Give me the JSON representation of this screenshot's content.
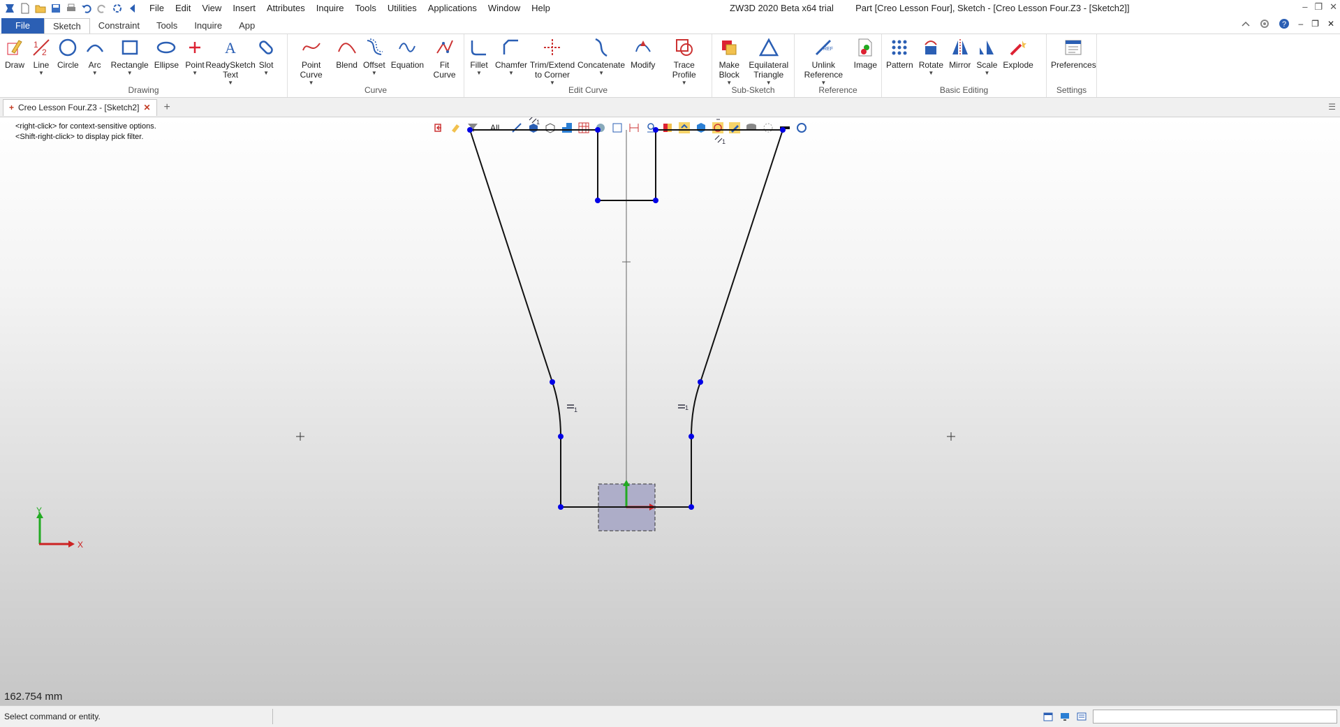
{
  "titlebar": {
    "menu": [
      "File",
      "Edit",
      "View",
      "Insert",
      "Attributes",
      "Inquire",
      "Tools",
      "Utilities",
      "Applications",
      "Window",
      "Help"
    ],
    "app_name": "ZW3D 2020 Beta x64 trial",
    "document": "Part [Creo Lesson Four],  Sketch - [Creo Lesson Four.Z3 - [Sketch2]]"
  },
  "ribbon_tabs": [
    "File",
    "Sketch",
    "Constraint",
    "Tools",
    "Inquire",
    "App"
  ],
  "ribbon": {
    "drawing": {
      "label": "Drawing",
      "buttons": [
        {
          "label": "Draw",
          "icon": "draw-icon"
        },
        {
          "label": "Line",
          "icon": "line-icon"
        },
        {
          "label": "Circle",
          "icon": "circle-icon"
        },
        {
          "label": "Arc",
          "icon": "arc-icon"
        },
        {
          "label": "Rectangle",
          "icon": "rectangle-icon"
        },
        {
          "label": "Ellipse",
          "icon": "ellipse-icon"
        },
        {
          "label": "Point",
          "icon": "point-icon"
        },
        {
          "label": "ReadySketch Text",
          "icon": "text-icon"
        },
        {
          "label": "Slot",
          "icon": "slot-icon"
        }
      ]
    },
    "curve": {
      "label": "Curve",
      "buttons": [
        {
          "label": "Point Curve",
          "icon": "point-curve-icon"
        },
        {
          "label": "Blend",
          "icon": "blend-icon"
        },
        {
          "label": "Offset",
          "icon": "offset-icon"
        },
        {
          "label": "Equation",
          "icon": "equation-icon"
        },
        {
          "label": "Fit Curve",
          "icon": "fit-curve-icon"
        }
      ]
    },
    "edit_curve": {
      "label": "Edit Curve",
      "buttons": [
        {
          "label": "Fillet",
          "icon": "fillet-icon"
        },
        {
          "label": "Chamfer",
          "icon": "chamfer-icon"
        },
        {
          "label": "Trim/Extend to Corner",
          "icon": "trim-icon"
        },
        {
          "label": "Concatenate",
          "icon": "concatenate-icon"
        },
        {
          "label": "Modify",
          "icon": "modify-icon"
        },
        {
          "label": "Trace Profile",
          "icon": "trace-profile-icon"
        }
      ]
    },
    "sub_sketch": {
      "label": "Sub-Sketch",
      "buttons": [
        {
          "label": "Make Block",
          "icon": "make-block-icon"
        },
        {
          "label": "Equilateral Triangle",
          "icon": "triangle-icon"
        }
      ]
    },
    "reference": {
      "label": "Reference",
      "buttons": [
        {
          "label": "Unlink Reference",
          "icon": "unlink-icon"
        },
        {
          "label": "Image",
          "icon": "image-icon"
        }
      ]
    },
    "basic_editing": {
      "label": "Basic Editing",
      "buttons": [
        {
          "label": "Pattern",
          "icon": "pattern-icon"
        },
        {
          "label": "Rotate",
          "icon": "rotate-icon"
        },
        {
          "label": "Mirror",
          "icon": "mirror-icon"
        },
        {
          "label": "Scale",
          "icon": "scale-icon"
        },
        {
          "label": "Explode",
          "icon": "explode-icon"
        }
      ]
    },
    "settings": {
      "label": "Settings",
      "buttons": [
        {
          "label": "Preferences",
          "icon": "preferences-icon"
        }
      ]
    }
  },
  "doc_tab": {
    "label": "Creo Lesson Four.Z3 - [Sketch2]"
  },
  "viewport": {
    "hint_1": "<right-click> for context-sensitive options.",
    "hint_2": "<Shift-right-click> to display pick filter.",
    "filter": "All",
    "measure": "162.754 mm",
    "axis_x": "X",
    "axis_y": "Y",
    "constraint_1": "1",
    "constraint_2": "1",
    "constraint_3": "1",
    "constraint_4": "1"
  },
  "status": {
    "text": "Select command or entity."
  },
  "colors": {
    "accent": "#2b5fb4",
    "point": "#0000e6",
    "sketch_line": "#111111"
  }
}
